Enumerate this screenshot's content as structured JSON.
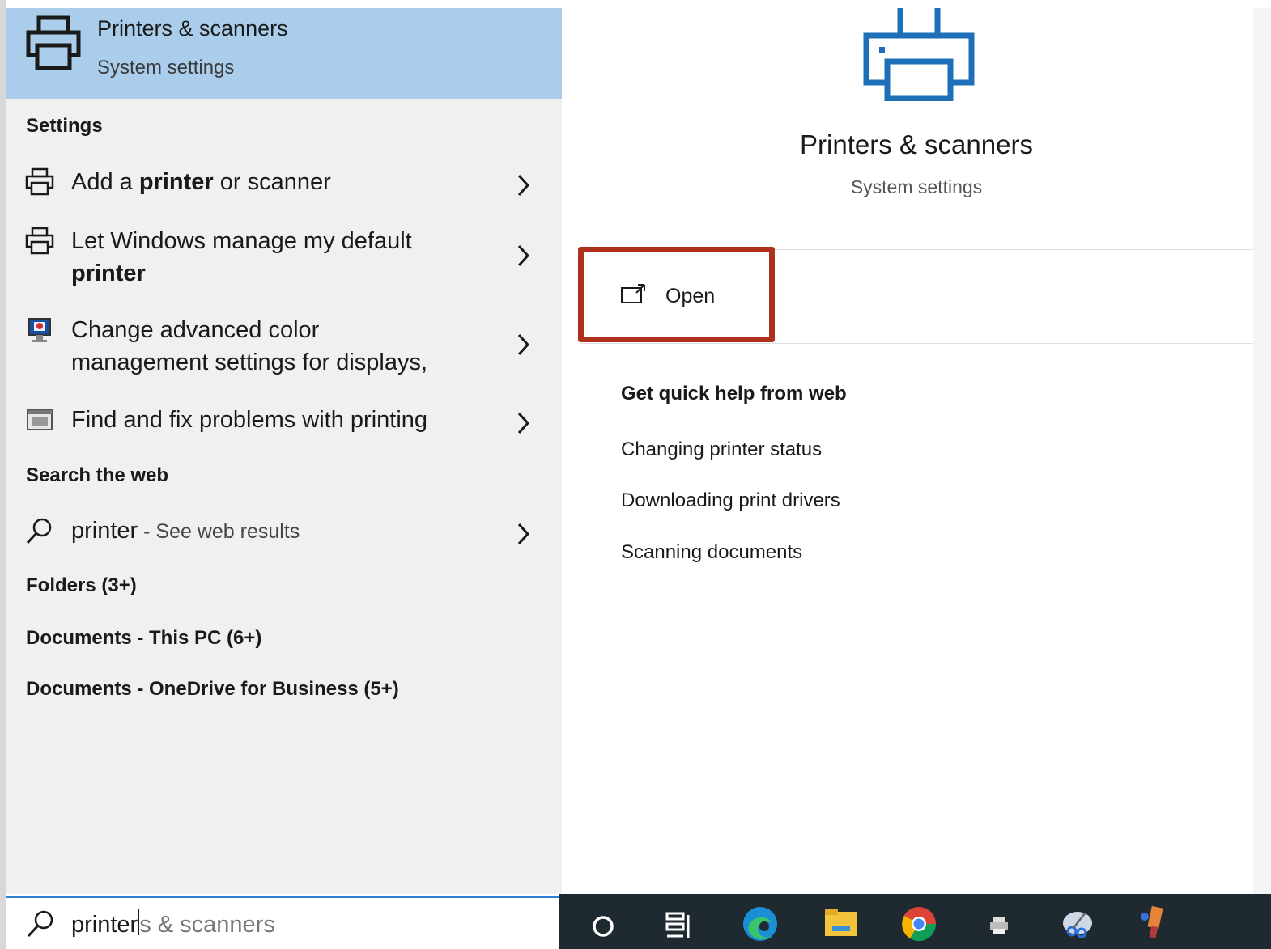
{
  "best_match": {
    "title": "Printers & scanners",
    "subtitle": "System settings",
    "icon": "printer-icon"
  },
  "sections": {
    "settings": "Settings",
    "search_web": "Search the web",
    "folders": "Folders (3+)",
    "documents_pc": "Documents - This PC (6+)",
    "documents_onedrive": "Documents - OneDrive for Business (5+)"
  },
  "settings_results": [
    {
      "pre": "Add a ",
      "bold": "printer",
      "post": " or scanner",
      "icon": "printer-small-icon"
    },
    {
      "line1": "Let Windows manage my default",
      "line2": "printer",
      "icon": "printer-small-icon"
    },
    {
      "line1": "Change advanced color",
      "line2": "management settings for displays,",
      "icon": "display-color-icon"
    },
    {
      "text": "Find and fix problems with printing",
      "icon": "troubleshoot-icon"
    }
  ],
  "web_result": {
    "term": "printer",
    "suffix": " - See web results",
    "icon": "search-icon"
  },
  "preview": {
    "title": "Printers & scanners",
    "subtitle": "System settings",
    "open_label": "Open",
    "help_heading": "Get quick help from web",
    "help_links": [
      "Changing printer status",
      "Downloading print drivers",
      "Scanning documents"
    ]
  },
  "search": {
    "typed": "printer",
    "suggestion_rest": "s & scanners"
  },
  "taskbar": {
    "items": [
      "cortana-icon",
      "task-view-icon",
      "edge-icon",
      "file-explorer-icon",
      "chrome-icon",
      "printer-app-icon",
      "snipping-tool-icon",
      "paint-icon"
    ]
  },
  "colors": {
    "accent": "#2c7fd1",
    "best_match_bg": "#a9cdea",
    "highlight_box": "#b0301e",
    "taskbar_bg": "#1f2a30",
    "printer_blue": "#1d6fb8"
  }
}
